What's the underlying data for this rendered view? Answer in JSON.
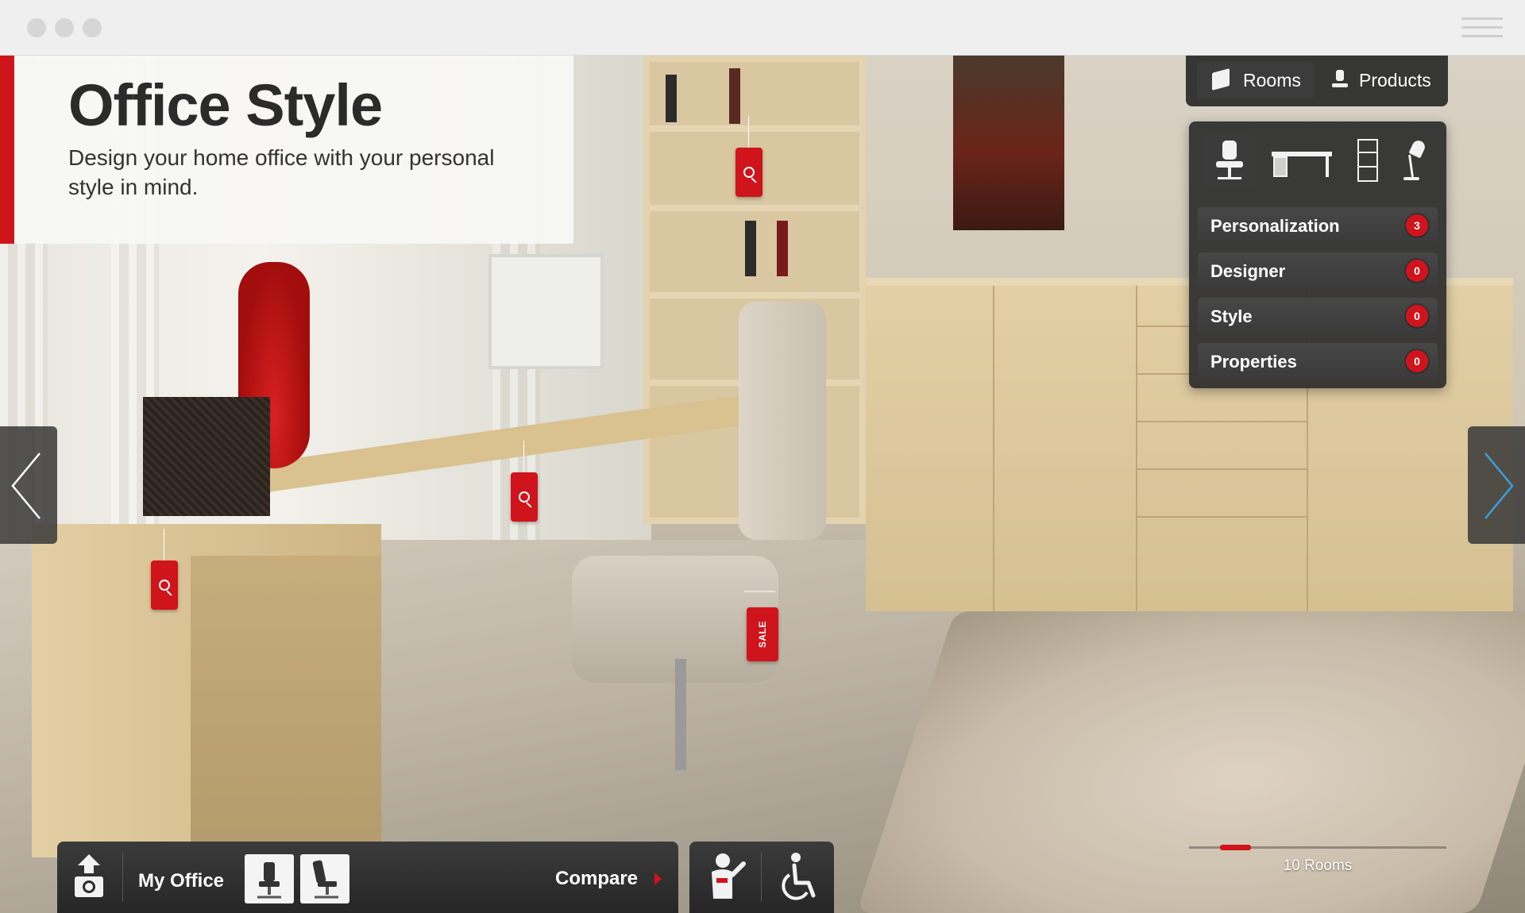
{
  "header": {
    "title": "Office Style",
    "subtitle": "Design your home office with your personal style in mind."
  },
  "toggle": {
    "rooms_label": "Rooms",
    "products_label": "Products",
    "active": "Rooms"
  },
  "categories": [
    {
      "icon": "office-chair-icon",
      "active": true
    },
    {
      "icon": "desk-icon",
      "active": false
    },
    {
      "icon": "filing-cabinet-icon",
      "active": false
    },
    {
      "icon": "desk-lamp-icon",
      "active": false
    }
  ],
  "filters": [
    {
      "label": "Personalization",
      "count": "3"
    },
    {
      "label": "Designer",
      "count": "0"
    },
    {
      "label": "Style",
      "count": "0"
    },
    {
      "label": "Properties",
      "count": "0"
    }
  ],
  "tags": {
    "sale_label": "SALE"
  },
  "pager": {
    "label": "10 Rooms",
    "current": 2,
    "total": 10
  },
  "bottom_bar": {
    "my_office_label": "My Office",
    "compare_label": "Compare",
    "thumbnails": [
      "office-chair-icon",
      "office-chair-icon"
    ],
    "icons": [
      "upload-photo-icon",
      "assistant-icon",
      "accessibility-icon"
    ]
  },
  "colors": {
    "accent": "#d0141b",
    "panel": "#2d2d2d",
    "title_text": "#2b2b2b"
  }
}
